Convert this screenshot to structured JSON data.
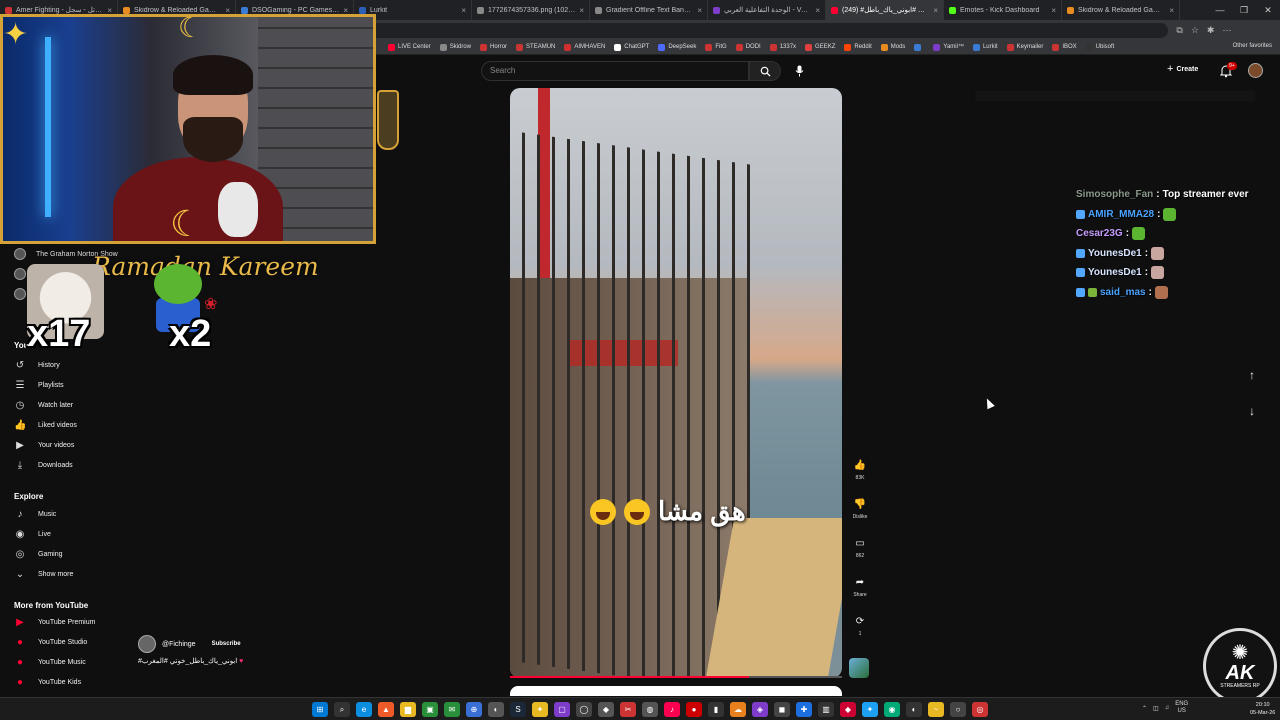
{
  "browser": {
    "tabs": [
      {
        "label": "Amer Fighting - عامر المقاتل - سجل",
        "color": "#cc3333",
        "active": false
      },
      {
        "label": "Skidrow & Reloaded Games - PC",
        "color": "#e88b20",
        "active": false
      },
      {
        "label": "DSOGaming - PC Games News, Ma",
        "color": "#3a7bd5",
        "active": false
      },
      {
        "label": "Lurkit",
        "color": "#2c5fb8",
        "active": false
      },
      {
        "label": "1772674357336.png (1027×413)",
        "color": "#888888",
        "active": false
      },
      {
        "label": "Gradient Offline Text Banner",
        "color": "#888888",
        "active": false
      },
      {
        "label": "الوحدة التفاعلية العربي - Vanilla محرر",
        "color": "#7d3cc9",
        "active": false
      },
      {
        "label": "(249) #المغرب #ابوني_ياك_باطل",
        "color": "#ff0033",
        "active": true
      },
      {
        "label": "Emotes - Kick Dashboard",
        "color": "#53fc18",
        "active": false
      },
      {
        "label": "Skidrow & Reloaded Games - Do",
        "color": "#e88b20",
        "active": false
      }
    ],
    "tab_close": "×",
    "url": "www.youtube.com/shorts/...",
    "window_controls": [
      "—",
      "❐",
      "✕"
    ],
    "bookmarks": [
      {
        "label": "LIVE Center",
        "color": "#ff0033"
      },
      {
        "label": "Skidrow",
        "color": "#888"
      },
      {
        "label": "Horror",
        "color": "#cc3333"
      },
      {
        "label": "STEAMUN",
        "color": "#cc3333"
      },
      {
        "label": "AIMHAVEN",
        "color": "#d03030"
      },
      {
        "label": "ChatGPT",
        "color": "#ffffff"
      },
      {
        "label": "DeepSeek",
        "color": "#4d6bfe"
      },
      {
        "label": "FitG",
        "color": "#cc3333"
      },
      {
        "label": "DODI",
        "color": "#cc3333"
      },
      {
        "label": "1337x",
        "color": "#cc3333"
      },
      {
        "label": "GEEKZ",
        "color": "#e04040"
      },
      {
        "label": "Reddit",
        "color": "#ff4500"
      },
      {
        "label": "Mods",
        "color": "#e88b20"
      },
      {
        "label": "",
        "color": "#3a7bd5"
      },
      {
        "label": "Yamil™",
        "color": "#7d3cc9"
      },
      {
        "label": "Lurkit",
        "color": "#3a7bd5"
      },
      {
        "label": "Keymailer",
        "color": "#cc3333"
      },
      {
        "label": "IBOX",
        "color": "#cc3333"
      },
      {
        "label": "Ubisoft",
        "color": "#333"
      }
    ],
    "other_favorites": "Other favorites"
  },
  "youtube": {
    "search_placeholder": "Search",
    "create_label": "Create",
    "notifications": "9+"
  },
  "overlay": {
    "ramadan_text": "Ramadan Kareem",
    "cat_count": "x17",
    "pepe_count": "x2"
  },
  "sidebar": {
    "subscriptions": [
      {
        "label": "The Graham Norton Show"
      },
      {
        "label": "..."
      },
      {
        "label": "..."
      }
    ],
    "you_heading": "You",
    "you_items": [
      {
        "icon": "↺",
        "label": "History"
      },
      {
        "icon": "☰",
        "label": "Playlists"
      },
      {
        "icon": "◷",
        "label": "Watch later"
      },
      {
        "icon": "👍",
        "label": "Liked videos"
      },
      {
        "icon": "▶",
        "label": "Your videos"
      },
      {
        "icon": "⤓",
        "label": "Downloads"
      }
    ],
    "explore_heading": "Explore",
    "explore_items": [
      {
        "icon": "♪",
        "label": "Music"
      },
      {
        "icon": "◉",
        "label": "Live"
      },
      {
        "icon": "◎",
        "label": "Gaming"
      },
      {
        "icon": "⌄",
        "label": "Show more"
      }
    ],
    "more_heading": "More from YouTube",
    "more_items": [
      {
        "icon": "▶",
        "label": "YouTube Premium"
      },
      {
        "icon": "●",
        "label": "YouTube Studio"
      },
      {
        "icon": "●",
        "label": "YouTube Music"
      },
      {
        "icon": "●",
        "label": "YouTube Kids"
      }
    ]
  },
  "short": {
    "caption": "هق مشا",
    "channel": "@Fichinge",
    "subscribe": "Subscribe",
    "title": "#ابوني_ياك_باطل_خوتي #المغرب",
    "progress": 0.72,
    "actions": {
      "likes": "83K",
      "dislike": "Dislike",
      "comments": "862",
      "share": "Share",
      "remix": "1"
    }
  },
  "chat": [
    {
      "user": "Simosophe_Fan",
      "color": "#8c9a8c",
      "message": "Top streamer ever",
      "badges": 0,
      "emote": ""
    },
    {
      "user": "AMIR_MMA28",
      "color": "#4aa3ff",
      "message": "",
      "badges": 1,
      "emote": "#5cb531"
    },
    {
      "user": "Cesar23G",
      "color": "#c79cff",
      "message": "",
      "badges": 0,
      "emote": "#5cb531"
    },
    {
      "user": "YounesDe1",
      "color": "#d7e4ff",
      "message": "",
      "badges": 1,
      "emote": "#c9a7a0"
    },
    {
      "user": "YounesDe1",
      "color": "#d7e4ff",
      "message": "",
      "badges": 1,
      "emote": "#c9a7a0"
    },
    {
      "user": "said_mas",
      "color": "#4aa3ff",
      "message": "",
      "badges": 2,
      "emote": "#b07050"
    }
  ],
  "watermark": {
    "brand": "AK",
    "sub": "STREAMERS RP"
  },
  "taskbar": {
    "apps": [
      {
        "icon": "⊞",
        "color": "#0078d4"
      },
      {
        "icon": "⌕",
        "color": "#333"
      },
      {
        "icon": "e",
        "color": "#0c8ee0"
      },
      {
        "icon": "▲",
        "color": "#f05a28"
      },
      {
        "icon": "▆",
        "color": "#e8b923"
      },
      {
        "icon": "▣",
        "color": "#2a8f3a"
      },
      {
        "icon": "✉",
        "color": "#2a8f3a"
      },
      {
        "icon": "⊕",
        "color": "#3a6fd5"
      },
      {
        "icon": "◐",
        "color": "#555"
      },
      {
        "icon": "S",
        "color": "#1b2838"
      },
      {
        "icon": "✦",
        "color": "#e8b923"
      },
      {
        "icon": "▢",
        "color": "#7d3cc9"
      },
      {
        "icon": "◯",
        "color": "#444"
      },
      {
        "icon": "◆",
        "color": "#555"
      },
      {
        "icon": "✂",
        "color": "#cc3333"
      },
      {
        "icon": "◍",
        "color": "#555"
      },
      {
        "icon": "♪",
        "color": "#ff0050"
      },
      {
        "icon": "●",
        "color": "#cc0000"
      },
      {
        "icon": "▮",
        "color": "#333"
      },
      {
        "icon": "☁",
        "color": "#e8801d"
      },
      {
        "icon": "◈",
        "color": "#7d3cc9"
      },
      {
        "icon": "◼",
        "color": "#444"
      },
      {
        "icon": "✚",
        "color": "#1d6fe0"
      },
      {
        "icon": "▥",
        "color": "#333"
      },
      {
        "icon": "◆",
        "color": "#cc0033"
      },
      {
        "icon": "✦",
        "color": "#1da1f2"
      },
      {
        "icon": "◉",
        "color": "#0a7"
      },
      {
        "icon": "◐",
        "color": "#333"
      },
      {
        "icon": "~",
        "color": "#e8b923"
      },
      {
        "icon": "○",
        "color": "#444"
      },
      {
        "icon": "◎",
        "color": "#c33"
      }
    ],
    "lang": "ENG",
    "region": "US",
    "time": "20:10",
    "date": "05-Mar-26"
  }
}
